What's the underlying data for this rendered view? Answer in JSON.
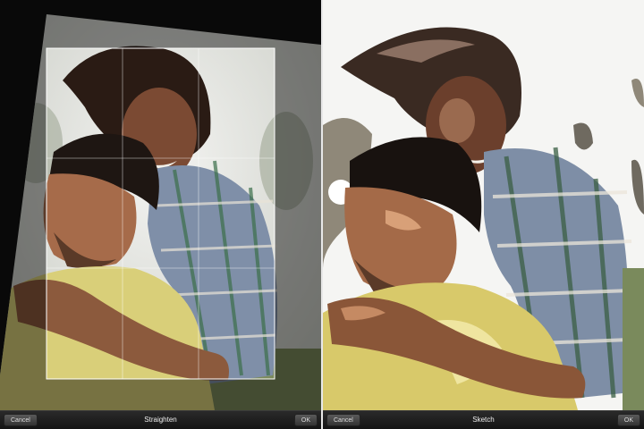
{
  "left_panel": {
    "tool_title": "Straighten",
    "cancel_label": "Cancel",
    "ok_label": "OK"
  },
  "right_panel": {
    "tool_title": "Sketch",
    "cancel_label": "Cancel",
    "ok_label": "OK"
  }
}
